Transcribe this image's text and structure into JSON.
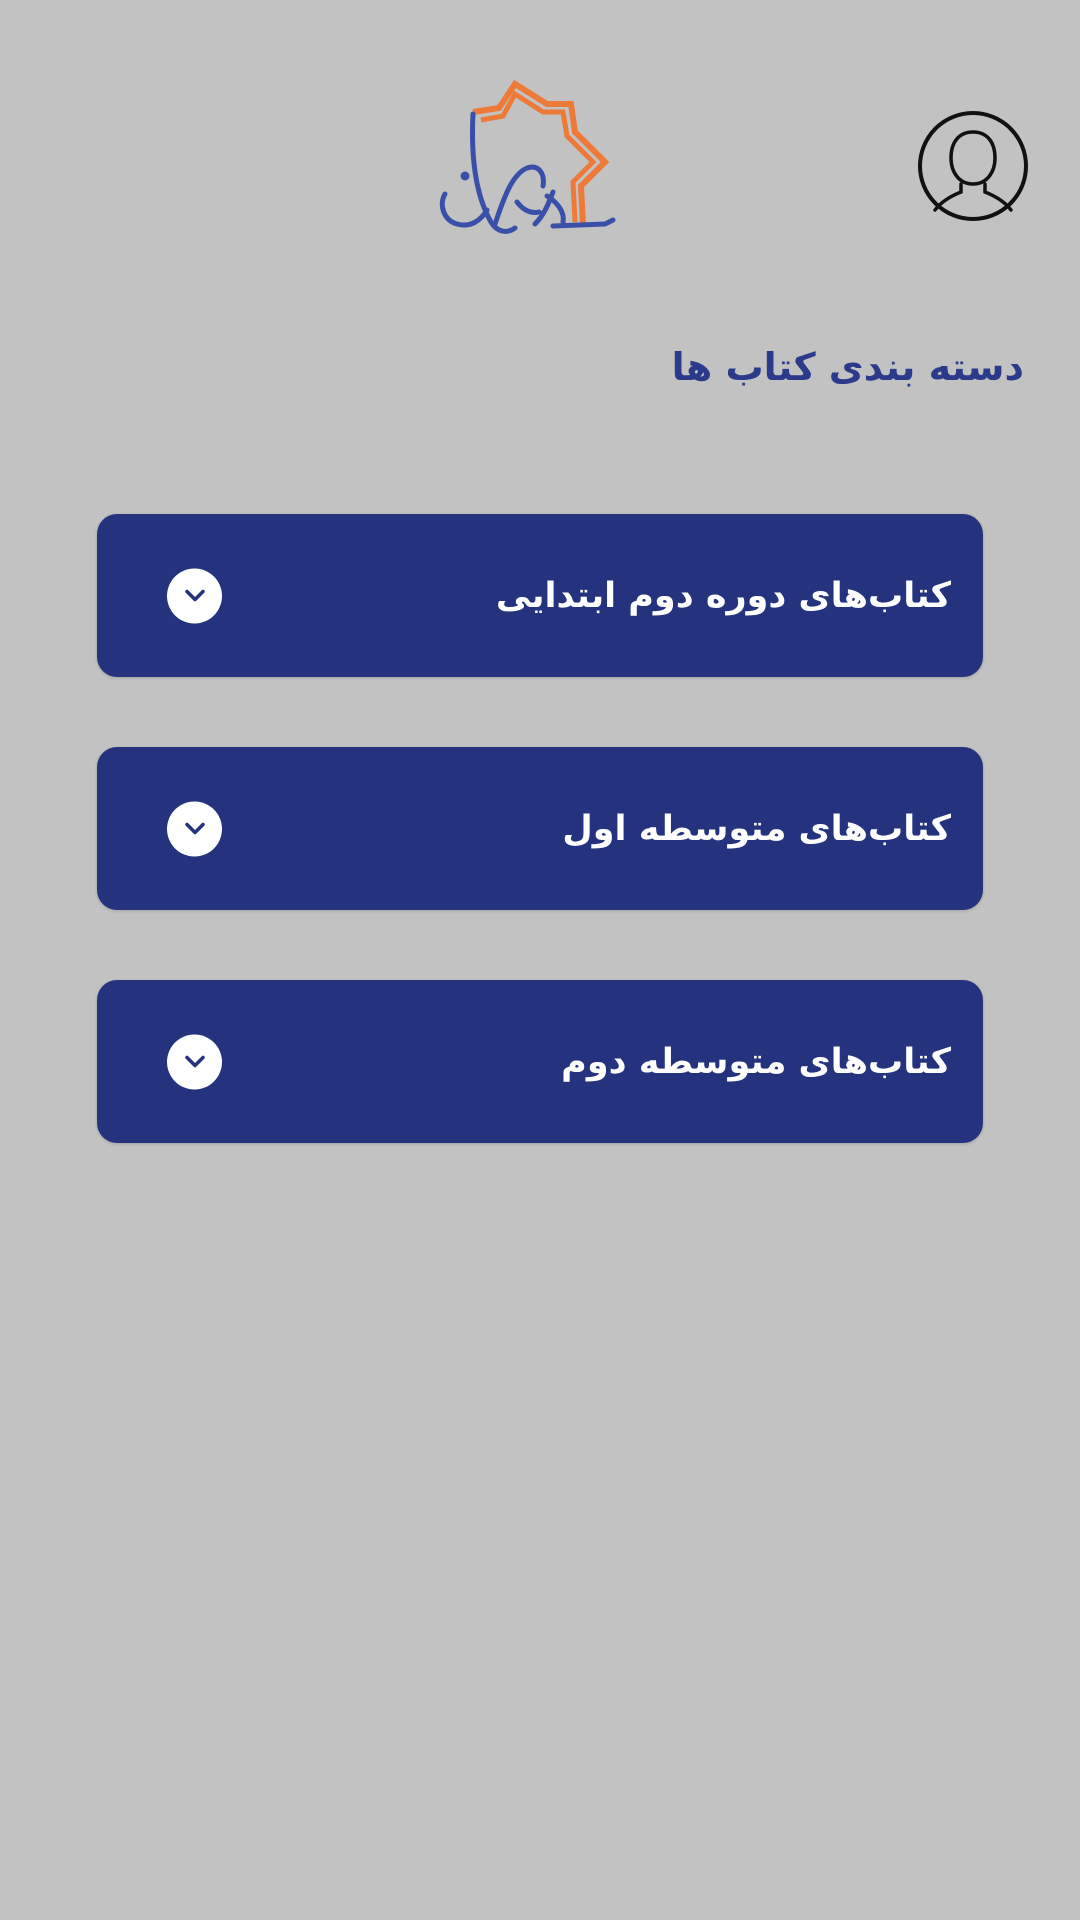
{
  "header": {
    "logo_name": "allameh-helli-logo",
    "profile_icon": "user-profile-icon"
  },
  "section": {
    "title": "دسته بندی کتاب ها"
  },
  "categories": [
    {
      "label": "کتاب‌های دوره دوم ابتدایی",
      "icon": "chevron-down-icon"
    },
    {
      "label": "کتاب‌های متوسطه اول",
      "icon": "chevron-down-icon"
    },
    {
      "label": "کتاب‌های متوسطه دوم",
      "icon": "chevron-down-icon"
    }
  ],
  "colors": {
    "background": "#c2c2c2",
    "primary": "#25337e",
    "title": "#2b3a8a",
    "logo_blue": "#3a4fa8",
    "logo_orange": "#ee7a3a",
    "white": "#ffffff"
  }
}
